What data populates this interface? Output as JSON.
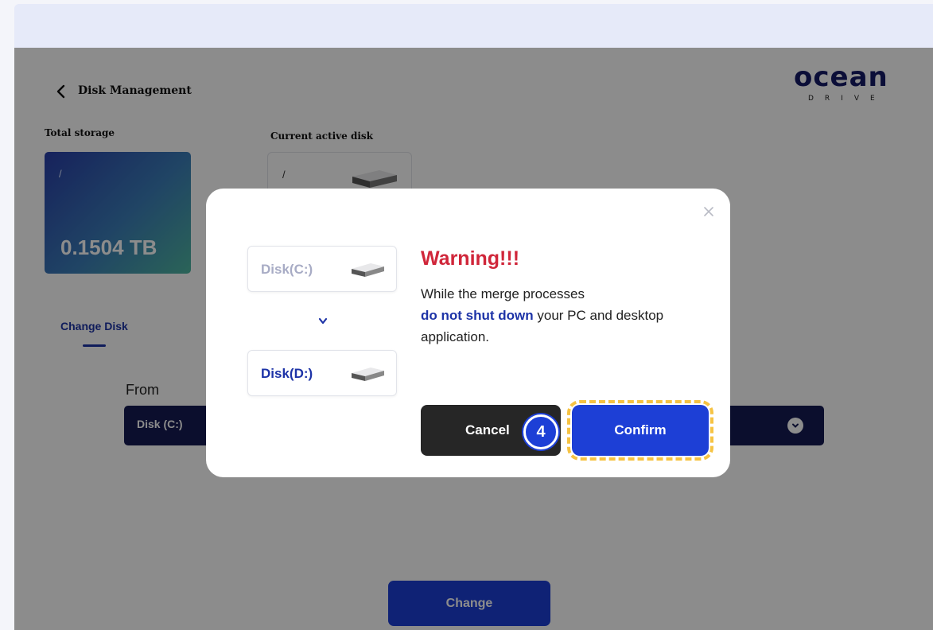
{
  "header": {
    "title": "Disk Management",
    "logo_main": "ocean",
    "logo_sub": "DRIVE"
  },
  "storage": {
    "total_label": "Total storage",
    "total_path": "/",
    "total_value": "0.1504 TB",
    "active_label": "Current active disk",
    "active_path": "/"
  },
  "tabs": {
    "change_disk": "Change Disk"
  },
  "form": {
    "from_label": "From",
    "from_value": "Disk (C:)",
    "change_button": "Change"
  },
  "modal": {
    "disk_from": "Disk(C:)",
    "disk_to": "Disk(D:)",
    "title": "Warning!!!",
    "body_line1": "While the merge processes",
    "body_highlight": "do not shut down",
    "body_rest": " your PC and desktop application.",
    "cancel_label": "Cancel",
    "confirm_label": "Confirm",
    "step_number": "4"
  },
  "colors": {
    "brand": "#1d3fd6",
    "warning": "#d0263a",
    "navy": "#141a52",
    "highlight_outline": "#f6c343"
  }
}
